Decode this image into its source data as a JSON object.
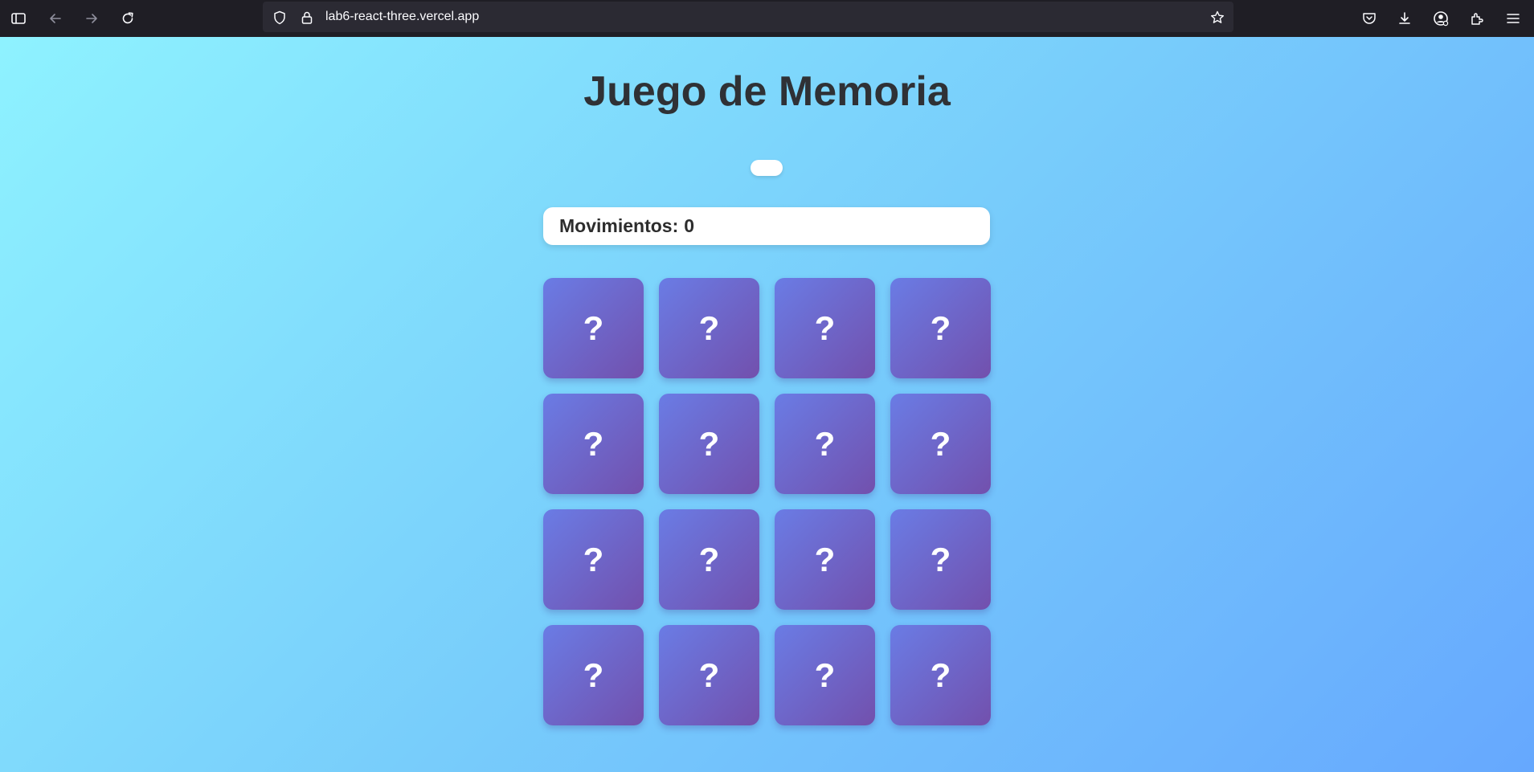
{
  "browser": {
    "url": "lab6-react-three.vercel.app",
    "icons": [
      "sidebar-icon",
      "back-arrow-icon",
      "forward-arrow-icon",
      "reload-icon",
      "shield-icon",
      "lock-icon",
      "star-bookmark-icon",
      "pocket-icon",
      "download-icon",
      "account-icon",
      "extensions-icon",
      "menu-icon"
    ]
  },
  "game": {
    "title": "Juego de Memoria",
    "restart_label": "",
    "moves_label": "Movimientos:",
    "moves_count": "0",
    "cards": [
      {
        "label": "?"
      },
      {
        "label": "?"
      },
      {
        "label": "?"
      },
      {
        "label": "?"
      },
      {
        "label": "?"
      },
      {
        "label": "?"
      },
      {
        "label": "?"
      },
      {
        "label": "?"
      },
      {
        "label": "?"
      },
      {
        "label": "?"
      },
      {
        "label": "?"
      },
      {
        "label": "?"
      },
      {
        "label": "?"
      },
      {
        "label": "?"
      },
      {
        "label": "?"
      },
      {
        "label": "?"
      }
    ]
  },
  "colors": {
    "card_gradient_start": "#6a7ce5",
    "card_gradient_end": "#7250ad",
    "background_start": "#8ef2ff",
    "background_end": "#66a8fe",
    "title_color": "#2f3135"
  }
}
